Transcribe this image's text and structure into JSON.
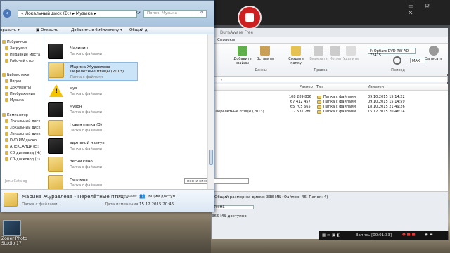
{
  "explorer": {
    "address": "« Локальный диск (D:) ▸ Музыка ▸",
    "search_placeholder": "Поиск: Музыка",
    "toolbar": {
      "organize": "оразить ▾",
      "open": "Открыть",
      "add_library": "Добавить в библиотеку ▾",
      "share": "Общий д"
    },
    "nav_items": [
      "Избранное",
      "Загрузки",
      "Недавние места",
      "Рабочий стол",
      "Библиотеки",
      "Видео",
      "Документы",
      "Изображения",
      "Музыка",
      "Компьютер",
      "Локальный диск",
      "Локальный диск",
      "Локальный диск",
      "DVD RW диско",
      "АЛЕКСАНДР (E:)",
      "CD-дисковод (H:)",
      "CD-дисковод (I:)",
      "Jenu Catalog"
    ],
    "items": [
      {
        "name": "Малинин",
        "sub": "Папка с файлами",
        "type": "folder"
      },
      {
        "name": "Марина Журавлева - Перелётные птицы (2013)",
        "sub": "Папка с файлами",
        "type": "folder"
      },
      {
        "name": "муз",
        "sub": "Папка с файлами",
        "type": "warning"
      },
      {
        "name": "музон",
        "sub": "Папка с файлами",
        "type": "dark"
      },
      {
        "name": "Новая папка (3)",
        "sub": "Папка с файлами",
        "type": "folder"
      },
      {
        "name": "одинокий пастух",
        "sub": "Папка с файлами",
        "type": "dark"
      },
      {
        "name": "песни кино",
        "sub": "Папка с файлами",
        "type": "folder"
      },
      {
        "name": "Петлюра",
        "sub": "Папка с файлами",
        "type": "folder"
      }
    ],
    "tooltip": "песни кино",
    "details": {
      "name": "Марина Журавлева - Перелётные птиц...",
      "type": "Папка с файлами",
      "state_label": "Состояние:",
      "state_value": "Общий доступ",
      "modified_label": "Дата изменения:",
      "modified_value": "15.12.2015 20:46"
    }
  },
  "burner": {
    "title": "BurnAware Free",
    "tab": "Спраекы",
    "ribbon": {
      "add": "Добавить файлы",
      "paste": "Вставить",
      "create": "Создать папку",
      "cut": "Вырезать",
      "copy": "Копир",
      "delete": "Удалить",
      "burn": "Записать",
      "drive": "F: Optiarc DVD RW AD-7241S",
      "speed": "MAX"
    },
    "groups": {
      "data": "Данны",
      "edit": "Правка",
      "record": "Привод"
    },
    "path": "\\",
    "columns": {
      "size": "Размер",
      "type": "Тип",
      "modified": "Изменен"
    },
    "rows": [
      {
        "name": "",
        "size": "108 289 836",
        "type": "Папка с файлами",
        "date": "09.10.2015 15:14:22"
      },
      {
        "name": "",
        "size": "67 412 457",
        "type": "Папка с файлами",
        "date": "09.10.2015 15:14:59"
      },
      {
        "name": "",
        "size": "65 705 665",
        "type": "Папка с файлами",
        "date": "18.10.2015 21:49:26"
      },
      {
        "name": "- Перелётные птицы (2013)",
        "size": "112 531 280",
        "type": "Папка с файлами",
        "date": "15.12.2015 20:46:14"
      }
    ],
    "status_used": "Общий размер на диске: 338 МБ (Файлов: 46, Папок: 4)",
    "capacity": "700МБ",
    "free": "365 МБ доступно"
  },
  "recording": {
    "label": "Запись [00:01:33]"
  },
  "desktop": {
    "zoner_label": "Zoner Photo Studio 17"
  }
}
